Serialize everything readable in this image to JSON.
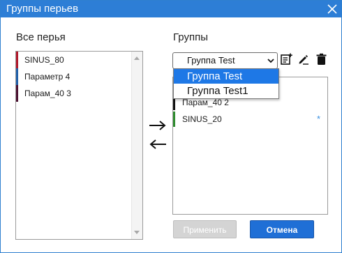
{
  "window": {
    "title": "Группы перьев"
  },
  "left": {
    "label": "Все перья",
    "items": [
      {
        "label": "SINUS_80",
        "color": "#b0172a"
      },
      {
        "label": "Параметр 4",
        "color": "#1f5fa8"
      },
      {
        "label": "Парам_40 3",
        "color": "#4a1030"
      }
    ]
  },
  "right": {
    "label": "Группы",
    "selected_group": "Группа Test",
    "dropdown_options": [
      "Группа Test",
      "Группа Test1"
    ],
    "items": [
      {
        "label": "Парам_40 2",
        "color": "#111111",
        "starred": false
      },
      {
        "label": "SINUS_20",
        "color": "#2e8b2e",
        "starred": true
      }
    ],
    "star_symbol": "*"
  },
  "icons": {
    "add": "add-note-icon",
    "rename": "edit-pen-icon",
    "delete": "trash-icon",
    "move_right": "arrow-right-icon",
    "move_left": "arrow-left-icon",
    "close": "close-icon"
  },
  "buttons": {
    "apply": "Применить",
    "cancel": "Отмена"
  },
  "colors": {
    "titlebar": "#2d7ed6",
    "accent": "#1f6fd6",
    "dropdown_highlight": "#1e78e6"
  }
}
